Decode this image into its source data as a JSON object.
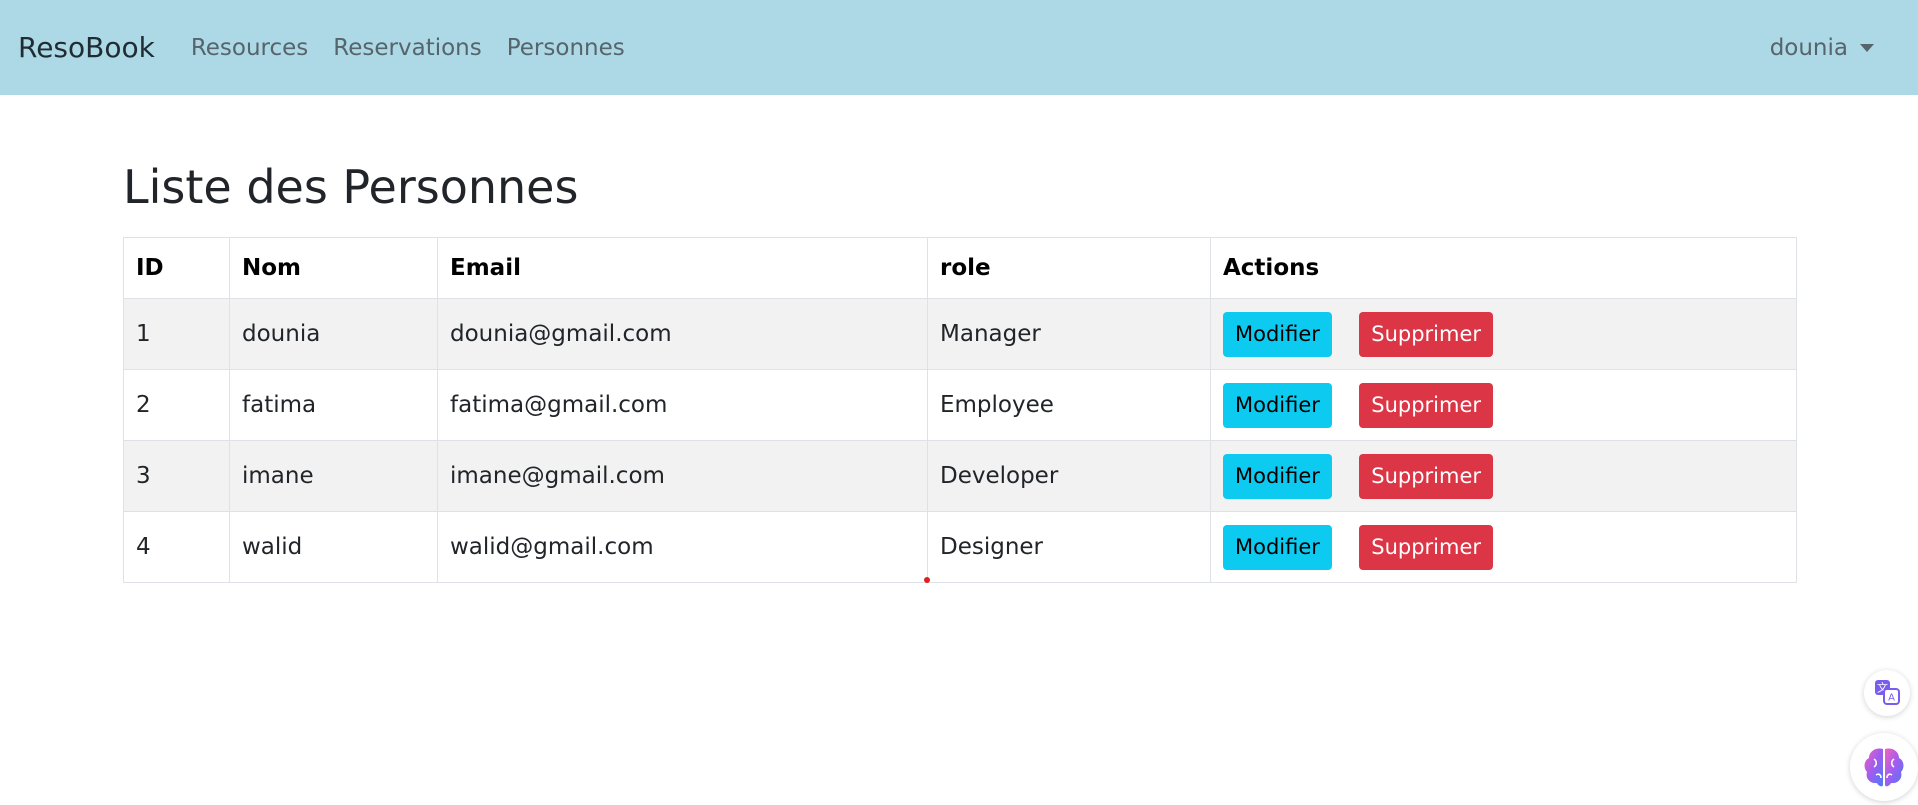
{
  "navbar": {
    "brand": "ResoBook",
    "links": [
      "Resources",
      "Reservations",
      "Personnes"
    ],
    "user": "dounia"
  },
  "page": {
    "title": "Liste des Personnes"
  },
  "table": {
    "headers": [
      "ID",
      "Nom",
      "Email",
      "role",
      "Actions"
    ],
    "rows": [
      {
        "id": "1",
        "nom": "dounia",
        "email": "dounia@gmail.com",
        "role": "Manager"
      },
      {
        "id": "2",
        "nom": "fatima",
        "email": "fatima@gmail.com",
        "role": "Employee"
      },
      {
        "id": "3",
        "nom": "imane",
        "email": "imane@gmail.com",
        "role": "Developer"
      },
      {
        "id": "4",
        "nom": "walid",
        "email": "walid@gmail.com",
        "role": "Designer"
      }
    ],
    "edit_label": "Modifier",
    "delete_label": "Supprimer"
  },
  "colors": {
    "navbar_bg": "#add8e6",
    "edit_button": "#0dcaf0",
    "delete_button": "#dc3545",
    "stripe": "#f2f2f2"
  },
  "floating_widgets": [
    "translate-icon",
    "brain-icon"
  ]
}
